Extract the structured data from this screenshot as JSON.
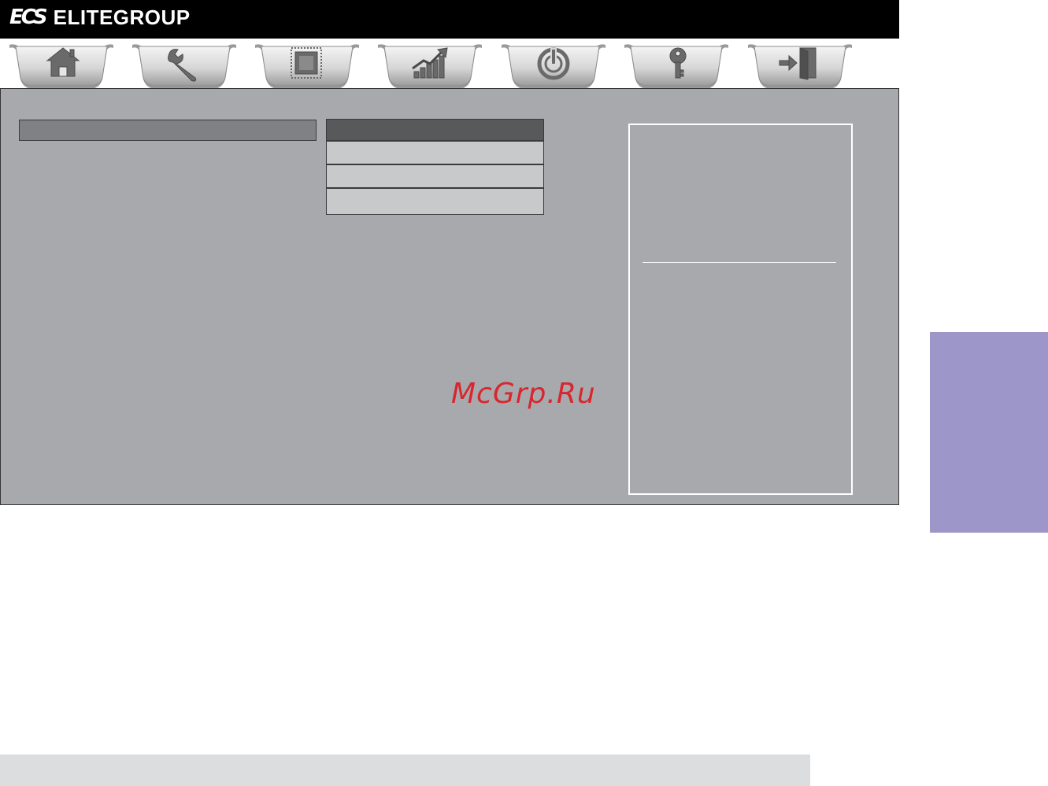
{
  "header": {
    "logo_mark": "ECS",
    "brand": "ELITEGROUP"
  },
  "tabs": [
    {
      "id": "main",
      "icon": "home-icon"
    },
    {
      "id": "advanced",
      "icon": "wrench-icon"
    },
    {
      "id": "chipset",
      "icon": "chip-icon"
    },
    {
      "id": "mib",
      "icon": "chart-icon"
    },
    {
      "id": "boot",
      "icon": "power-icon"
    },
    {
      "id": "security",
      "icon": "key-icon"
    },
    {
      "id": "exit",
      "icon": "exit-door-icon"
    }
  ],
  "watermark": {
    "text": "McGrp.Ru"
  },
  "colors": {
    "header_bg": "#000000",
    "panel_bg": "#a8a9ad",
    "left_bar": "#808184",
    "menu_header": "#58595b",
    "menu_item": "#c8c9cb",
    "side_tab": "#9d96c8",
    "footer": "#dcdddf",
    "watermark": "#d8262e"
  }
}
